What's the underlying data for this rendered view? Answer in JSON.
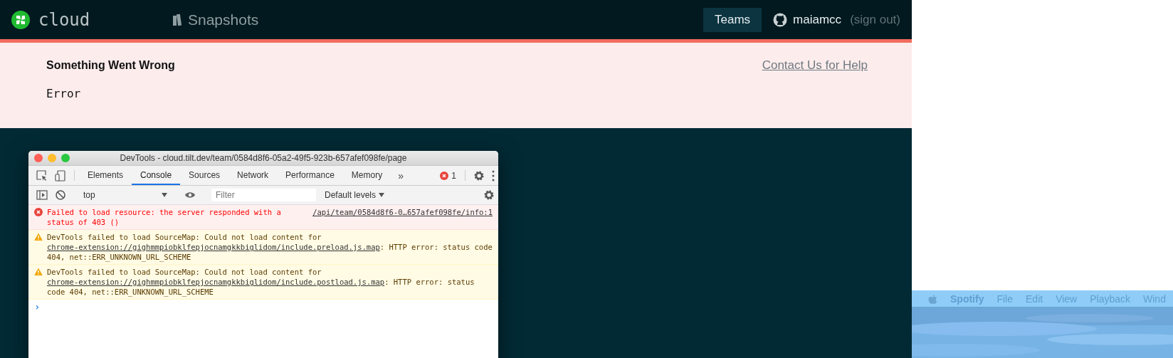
{
  "header": {
    "logo_text": "cloud",
    "nav": [
      {
        "label": "Snapshots"
      }
    ],
    "teams_button": "Teams",
    "username": "maiamcc",
    "sign_out": "(sign out)"
  },
  "error_banner": {
    "title": "Something Went Wrong",
    "message": "Error",
    "help_link": "Contact Us for Help"
  },
  "devtools": {
    "title": "DevTools - cloud.tilt.dev/team/0584d8f6-05a2-49f5-923b-657afef098fe/page",
    "tabs": [
      {
        "label": "Elements",
        "selected": false
      },
      {
        "label": "Console",
        "selected": true
      },
      {
        "label": "Sources",
        "selected": false
      },
      {
        "label": "Network",
        "selected": false
      },
      {
        "label": "Performance",
        "selected": false
      },
      {
        "label": "Memory",
        "selected": false
      }
    ],
    "more": "»",
    "error_count": "1",
    "context": "top",
    "filter_placeholder": "Filter",
    "levels": "Default levels",
    "messages": [
      {
        "kind": "error",
        "text": "Failed to load resource: the server responded with a status of 403 ()",
        "source": "/api/team/0584d8f6-0…657afef098fe/info:1"
      },
      {
        "kind": "warning",
        "text": "DevTools failed to load SourceMap: Could not load content for",
        "link": "chrome-extension://gighmmpiobklfepjocnamgkkbiglidom/include.preload.js.map",
        "text_after": ": HTTP error: status code 404, net::ERR_UNKNOWN_URL_SCHEME"
      },
      {
        "kind": "warning",
        "text": "DevTools failed to load SourceMap: Could not load content for",
        "link": "chrome-extension://gighmmpiobklfepjocnamgkkbiglidom/include.postload.js.map",
        "text_after": ": HTTP error: status code 404, net::ERR_UNKNOWN_URL_SCHEME"
      }
    ],
    "prompt": "›"
  },
  "desktop_menubar": {
    "items": [
      {
        "label": "Spotify",
        "kind": "app"
      },
      {
        "label": "File",
        "kind": "menu"
      },
      {
        "label": "Edit",
        "kind": "menu"
      },
      {
        "label": "View",
        "kind": "menu"
      },
      {
        "label": "Playback",
        "kind": "menu"
      },
      {
        "label": "Wind",
        "kind": "menu"
      }
    ]
  }
}
